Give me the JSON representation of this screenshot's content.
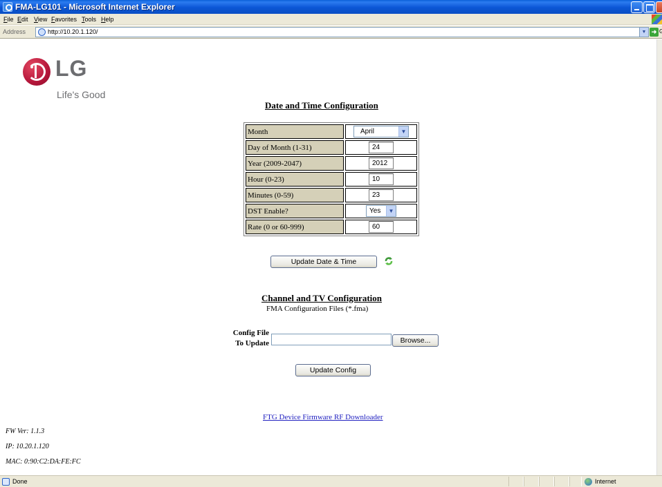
{
  "window": {
    "title": "FMA-LG101 - Microsoft Internet Explorer"
  },
  "menu": [
    "File",
    "Edit",
    "View",
    "Favorites",
    "Tools",
    "Help"
  ],
  "address": {
    "label": "Address",
    "url": "http://10.20.1.120/",
    "go_label": "Go"
  },
  "logo": {
    "word": "LG",
    "tagline": "Life's Good"
  },
  "date_section": {
    "title": "Date and Time Configuration",
    "rows": {
      "month": {
        "label": "Month",
        "value": "April"
      },
      "day": {
        "label": "Day of Month (1-31)",
        "value": "24"
      },
      "year": {
        "label": "Year (2009-2047)",
        "value": "2012"
      },
      "hour": {
        "label": "Hour (0-23)",
        "value": "10"
      },
      "minutes": {
        "label": "Minutes (0-59)",
        "value": "23"
      },
      "dst": {
        "label": "DST Enable?",
        "value": "Yes"
      },
      "rate": {
        "label": "Rate (0 or 60-999)",
        "value": "60"
      }
    },
    "update_button": "Update Date & Time"
  },
  "channel_section": {
    "title": "Channel and TV Configuration",
    "caption": "FMA Configuration Files (*.fma)",
    "config_label_line1": "Config File",
    "config_label_line2": "To Update",
    "file_value": "",
    "browse_button": "Browse...",
    "update_button": "Update Config"
  },
  "firmware_link": "FTG Device Firmware RF Downloader",
  "device_info": {
    "fw": "FW Ver: 1.1.3",
    "ip": "IP: 10.20.1.120",
    "mac": "MAC: 0:90:C2:DA:FE:FC"
  },
  "status": {
    "text": "Done",
    "zone": "Internet"
  }
}
